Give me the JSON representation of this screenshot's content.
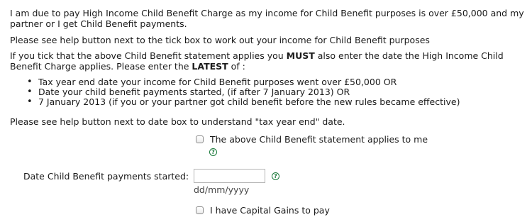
{
  "statement": "I am due to pay High Income Child Benefit Charge as my income for Child Benefit purposes is over £50,000 and my partner or I get Child Benefit payments.",
  "help_note_checkbox": "Please see help button next to the tick box to work out your income for Child Benefit purposes",
  "instruction": {
    "part1": "If you tick that the above Child Benefit statement applies you ",
    "must": "MUST",
    "part2": " also enter the date the High Income Child Benefit Charge applies. Please enter the ",
    "latest": "LATEST",
    "part3": " of :"
  },
  "bullets": [
    "Tax year end date your income for Child Benefit purposes went over £50,000 OR",
    "Date your child benefit payments started, (if after 7 January 2013) OR",
    "7 January 2013 (if you or your partner got child benefit before the new rules became effective)"
  ],
  "help_note_date": "Please see help button next to date box to understand \"tax year end\" date.",
  "checkbox_child_benefit": {
    "label": "The above Child Benefit statement applies to me",
    "checked": false
  },
  "help_icon_glyph": "?",
  "date_field": {
    "label": "Date Child Benefit payments started:",
    "value": "",
    "hint": "dd/mm/yyyy"
  },
  "checkbox_capital_gains": {
    "label": "I have Capital Gains to pay",
    "checked": false
  },
  "colors": {
    "help_icon": "#1a7a3a",
    "text": "#1a1a1a"
  }
}
